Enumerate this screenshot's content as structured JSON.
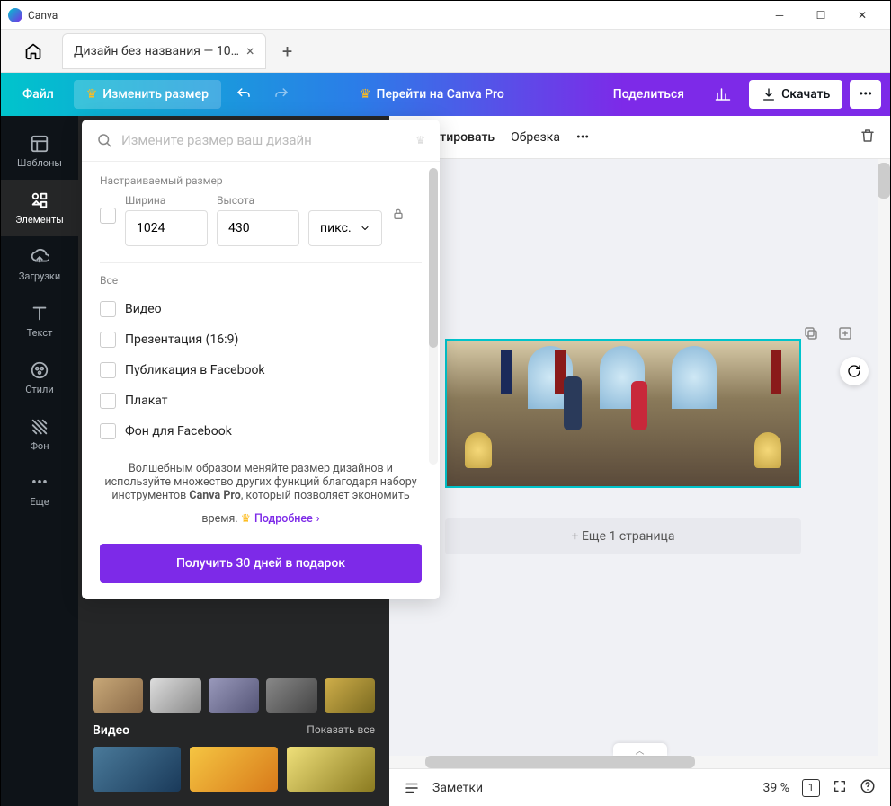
{
  "app": {
    "name": "Canva"
  },
  "tab": {
    "title": "Дизайн без названия — 10…"
  },
  "toolbar": {
    "file": "Файл",
    "resize": "Изменить размер",
    "pro": "Перейти на Canva Pro",
    "share": "Поделиться",
    "download": "Скачать"
  },
  "sidebar": {
    "templates": "Шаблоны",
    "elements": "Элементы",
    "uploads": "Загрузки",
    "text": "Текст",
    "styles": "Стили",
    "background": "Фон",
    "more": "Еще"
  },
  "resize_panel": {
    "search_placeholder": "Измените размер ваш дизайн",
    "custom_label": "Настраиваемый размер",
    "width_label": "Ширина",
    "height_label": "Высота",
    "width": "1024",
    "height": "430",
    "unit": "пикс.",
    "all_label": "Все",
    "options": [
      "Видео",
      "Презентация (16:9)",
      "Публикация в Facebook",
      "Плакат",
      "Фон для Facebook"
    ],
    "promo_text_1": "Волшебным образом меняйте размер дизайнов и используйте множество других функций благодаря набору инструментов ",
    "promo_bold": "Canva Pro",
    "promo_text_2": ", который позволяет экономить время.",
    "more_link": "Подробнее",
    "cta": "Получить 30 дней в подарок"
  },
  "sidepanel": {
    "video_heading": "Видео",
    "show_all": "Показать все"
  },
  "canvas_toolbar": {
    "edit": "Редактировать",
    "crop": "Обрезка"
  },
  "canvas": {
    "add_page": "+ Еще 1 страница"
  },
  "bottombar": {
    "notes": "Заметки",
    "zoom": "39 %",
    "page": "1"
  }
}
